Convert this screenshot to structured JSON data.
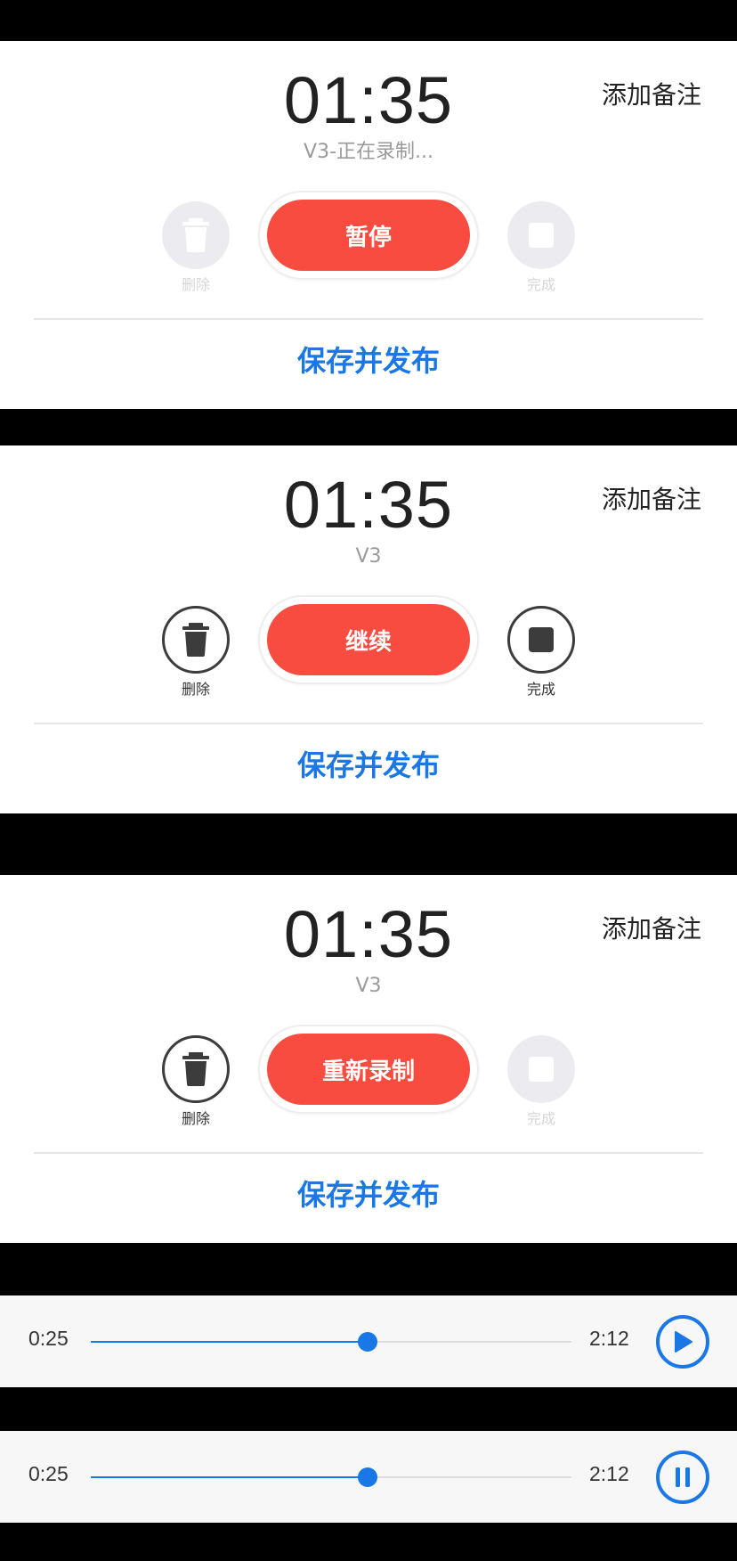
{
  "panels": [
    {
      "timer": "01:35",
      "status": "V3-正在录制...",
      "note_label": "添加备注",
      "primary_label": "暂停",
      "delete_label": "删除",
      "delete_enabled": false,
      "done_label": "完成",
      "done_enabled": false,
      "publish_label": "保存并发布"
    },
    {
      "timer": "01:35",
      "status": "V3",
      "note_label": "添加备注",
      "primary_label": "继续",
      "delete_label": "删除",
      "delete_enabled": true,
      "done_label": "完成",
      "done_enabled": true,
      "publish_label": "保存并发布"
    },
    {
      "timer": "01:35",
      "status": "V3",
      "note_label": "添加备注",
      "primary_label": "重新录制",
      "delete_label": "删除",
      "delete_enabled": true,
      "done_label": "完成",
      "done_enabled": false,
      "publish_label": "保存并发布"
    }
  ],
  "players": [
    {
      "current_time": "0:25",
      "total_time": "2:12",
      "progress": 0.575,
      "state_icon": "play-icon"
    },
    {
      "current_time": "0:25",
      "total_time": "2:12",
      "progress": 0.575,
      "state_icon": "pause-icon"
    }
  ],
  "colors": {
    "accent_red": "#f74c3f",
    "link_blue": "#1977e6",
    "disabled_gray": "#ececf0",
    "icon_dark": "#3c3c3c",
    "icon_disabled": "#ffffff"
  }
}
